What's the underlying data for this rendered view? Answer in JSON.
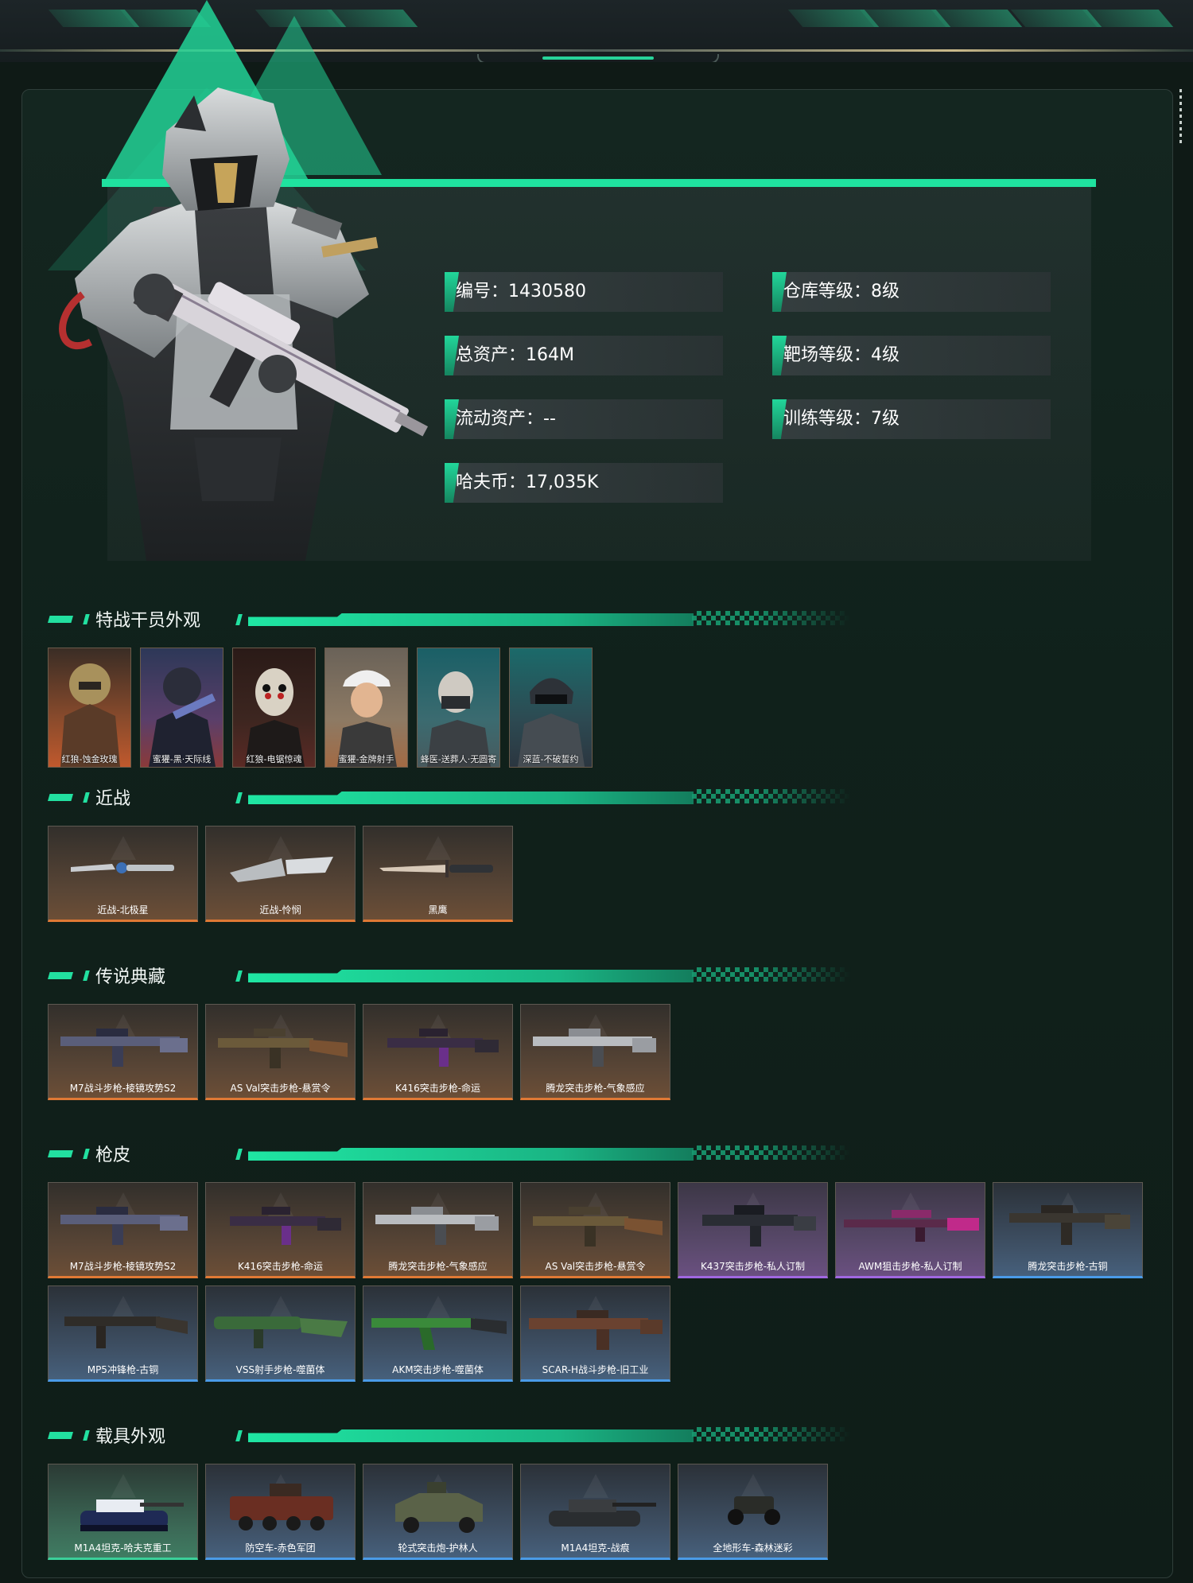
{
  "player": {
    "stats": [
      {
        "label": "编号：",
        "value": "1430580"
      },
      {
        "label": "仓库等级：",
        "value": "8级"
      },
      {
        "label": "总资产：",
        "value": "164M"
      },
      {
        "label": "靶场等级：",
        "value": "4级"
      },
      {
        "label": "流动资产：",
        "value": "--"
      },
      {
        "label": "训练等级：",
        "value": "7级"
      },
      {
        "label": "哈夫币：",
        "value": "17,035K"
      }
    ]
  },
  "sections": {
    "operators": {
      "title": "特战干员外观",
      "items": [
        "红狼-蚀金玫瑰",
        "蜜獾-黑·天际线",
        "红狼-电锯惊魂",
        "蜜獾-金牌射手",
        "蜂医-送葬人·无圆寄",
        "深蓝-不破誓约"
      ]
    },
    "melee": {
      "title": "近战",
      "items": [
        "近战-北极星",
        "近战-怜悯",
        "黑鹰"
      ]
    },
    "legend": {
      "title": "传说典藏",
      "items": [
        "M7战斗步枪-棱镜攻势S2",
        "AS Val突击步枪-悬赏令",
        "K416突击步枪-命运",
        "腾龙突击步枪-气象感应"
      ]
    },
    "skins": {
      "title": "枪皮",
      "items": [
        "M7战斗步枪-棱镜攻势S2",
        "K416突击步枪-命运",
        "腾龙突击步枪-气象感应",
        "AS Val突击步枪-悬赏令",
        "K437突击步枪-私人订制",
        "AWM狙击步枪-私人订制",
        "腾龙突击步枪-古铜",
        "MP5冲锋枪-古铜",
        "VSS射手步枪-噬菌体",
        "AKM突击步枪-噬菌体",
        "SCAR-H战斗步枪-旧工业"
      ]
    },
    "vehicles": {
      "title": "载具外观",
      "items": [
        "M1A4坦克-哈夫克重工",
        "防空车-赤色军团",
        "轮式突击炮-护林人",
        "M1A4坦克-战痕",
        "全地形车-森林迷彩"
      ]
    }
  },
  "colors": {
    "accent": "#1fe29f",
    "rarity_orange": "#e07935",
    "rarity_purple": "#a067e0",
    "rarity_blue": "#4a9be8",
    "rarity_green": "#3bd09a"
  }
}
